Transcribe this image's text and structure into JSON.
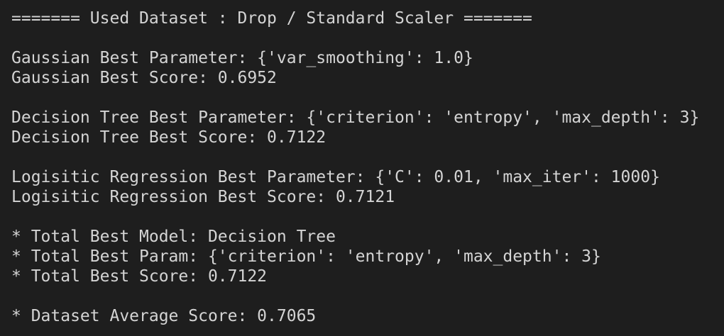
{
  "output": {
    "header": "======= Used Dataset : Drop / Standard Scaler =======",
    "gaussian_param": "Gaussian Best Parameter: {'var_smoothing': 1.0}",
    "gaussian_score": "Gaussian Best Score: 0.6952",
    "tree_param": "Decision Tree Best Parameter: {'criterion': 'entropy', 'max_depth': 3}",
    "tree_score": "Decision Tree Best Score: 0.7122",
    "logistic_param": "Logisitic Regression Best Parameter: {'C': 0.01, 'max_iter': 1000}",
    "logistic_score": "Logisitic Regression Best Score: 0.7121",
    "total_model": "* Total Best Model: Decision Tree",
    "total_param": "* Total Best Param: {'criterion': 'entropy', 'max_depth': 3}",
    "total_score": "* Total Best Score: 0.7122",
    "average_score": "* Dataset Average Score: 0.7065"
  },
  "colors": {
    "background": "#1e1e1e",
    "text": "#d4d4d4"
  }
}
